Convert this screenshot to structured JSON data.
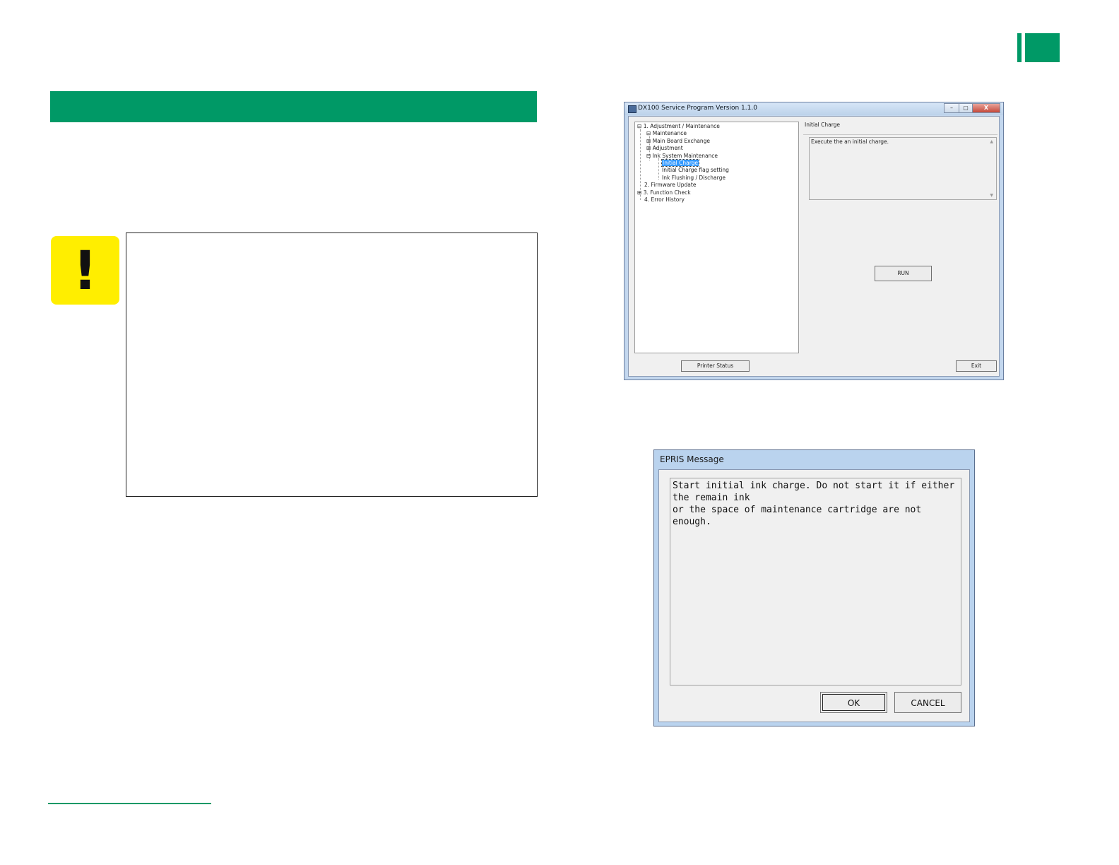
{
  "service_window": {
    "title": "DX100 Service Program  Version 1.1.0",
    "window_buttons": {
      "minimize": "–",
      "maximize": "▢",
      "close": "X"
    },
    "tree": [
      {
        "label": "1. Adjustment / Maintenance",
        "expander": "⊟"
      },
      {
        "label": "Maintenance",
        "expander": "⊟"
      },
      {
        "label": "Main Board Exchange",
        "expander": "⊞"
      },
      {
        "label": "Adjustment",
        "expander": "⊞"
      },
      {
        "label": "Ink System Maintenance",
        "expander": "⊟"
      },
      {
        "label": "Initial Charge",
        "selected": true
      },
      {
        "label": "Initial Charge flag setting"
      },
      {
        "label": "Ink Flushing / Discharge"
      },
      {
        "label": "2. Firmware Update"
      },
      {
        "label": "3. Function Check",
        "expander": "⊞"
      },
      {
        "label": "4. Error History"
      }
    ],
    "panel_title": "Initial Charge",
    "description": "Execute the an initial charge.",
    "run_label": "RUN",
    "printer_status_label": "Printer Status",
    "exit_label": "Exit"
  },
  "dialog": {
    "title": "EPRIS Message",
    "message_line1": "Start initial ink charge. Do not start it if either the remain ink",
    "message_line2": "or the space of maintenance cartridge are not enough.",
    "ok_label": "OK",
    "cancel_label": "CANCEL"
  },
  "warning_icon": "exclamation-icon",
  "colors": {
    "brand_green": "#009966",
    "warning_yellow": "#ffee00",
    "selection_blue": "#3399ff"
  }
}
